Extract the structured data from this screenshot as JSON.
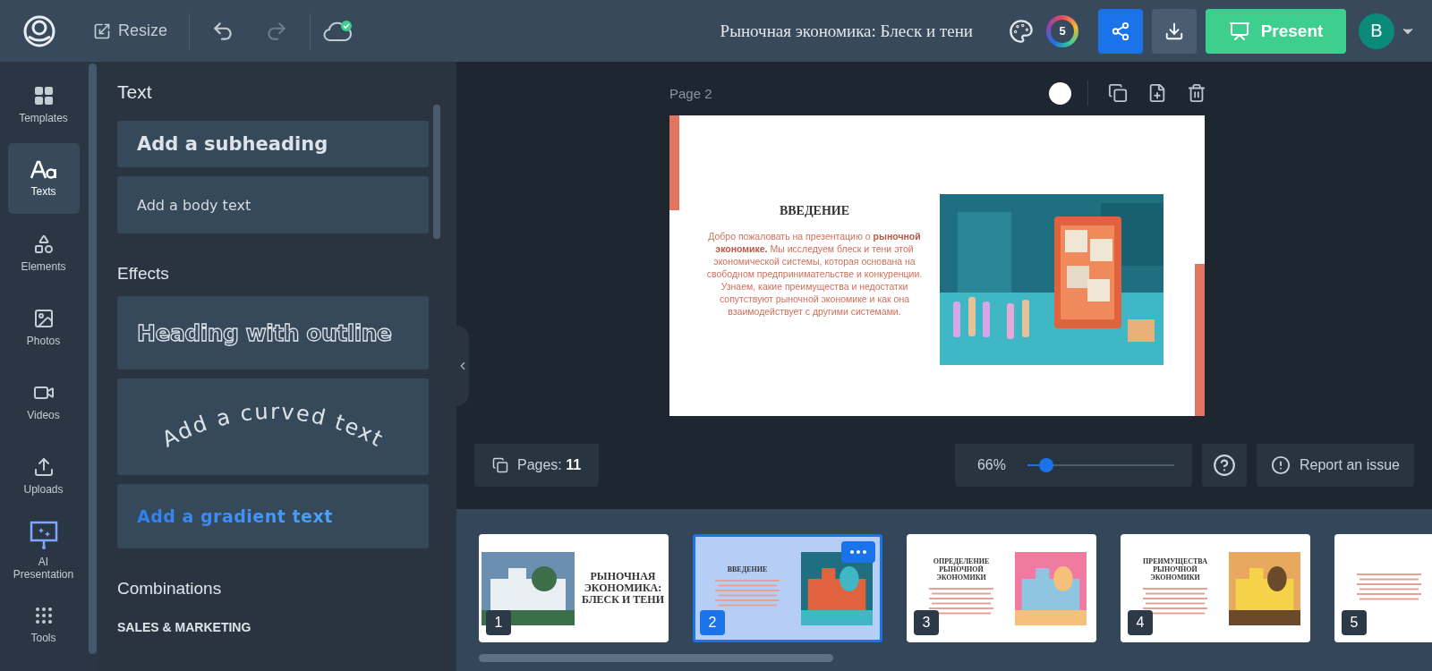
{
  "topbar": {
    "resize_label": "Resize",
    "undo_enabled": true,
    "redo_enabled": false,
    "title": "Рыночная экономика: Блеск и тени",
    "collaborators": "5",
    "present_label": "Present",
    "avatar_initial": "B"
  },
  "rail": [
    {
      "kind": "templates",
      "label": "Templates",
      "selected": false
    },
    {
      "kind": "texts",
      "label": "Texts",
      "selected": true
    },
    {
      "kind": "elements",
      "label": "Elements",
      "selected": false
    },
    {
      "kind": "photos",
      "label": "Photos",
      "selected": false
    },
    {
      "kind": "videos",
      "label": "Videos",
      "selected": false
    },
    {
      "kind": "uploads",
      "label": "Uploads",
      "selected": false
    },
    {
      "kind": "ai",
      "label": "AI Presentation",
      "selected": false
    },
    {
      "kind": "tools",
      "label": "Tools",
      "selected": false
    }
  ],
  "panel": {
    "title": "Text",
    "basic_items": [
      {
        "kind": "subheading",
        "label": "Add a subheading"
      },
      {
        "kind": "body",
        "label": "Add a body text"
      }
    ],
    "effects_heading": "Effects",
    "effect_items": [
      {
        "kind": "outline",
        "label": "Heading with outline"
      },
      {
        "kind": "curved",
        "label": "Add a curved text"
      },
      {
        "kind": "gradient",
        "label": "Add a gradient text"
      }
    ],
    "combinations_heading": "Combinations",
    "combination_category": "SALES & MARKETING"
  },
  "canvas": {
    "page_label": "Page 2",
    "slide": {
      "heading": "ВВЕДЕНИЕ",
      "body": "Добро пожаловать на презентацию о **рыночной экономике.**  Мы исследуем блеск и тени этой экономической системы, которая основана на свободном предпринимательстве и конкуренции. Узнаем, какие преимущества и недостатки сопутствуют рыночной экономике и как она взаимодействует с другими системами."
    }
  },
  "footer": {
    "pages_label": "Pages:",
    "pages_count": "11",
    "zoom": {
      "reading": "66%",
      "level": 0.13
    },
    "report_label": "Report an issue"
  },
  "thumbnails": [
    {
      "number": "1",
      "title": "РЫНОЧНАЯ ЭКОНОМИКА: БЛЕСК И ТЕНИ",
      "kind": "cover",
      "selected": false
    },
    {
      "number": "2",
      "title": "ВВЕДЕНИЕ",
      "kind": "text-left",
      "selected": true
    },
    {
      "number": "3",
      "title": "ОПРЕДЕЛЕНИЕ РЫНОЧНОЙ ЭКОНОМИКИ",
      "kind": "text-left",
      "selected": false
    },
    {
      "number": "4",
      "title": "ПРЕИМУЩЕСТВА РЫНОЧНОЙ ЭКОНОМИКИ",
      "kind": "text-left",
      "selected": false
    },
    {
      "number": "5",
      "kind": "partial",
      "selected": false
    }
  ]
}
